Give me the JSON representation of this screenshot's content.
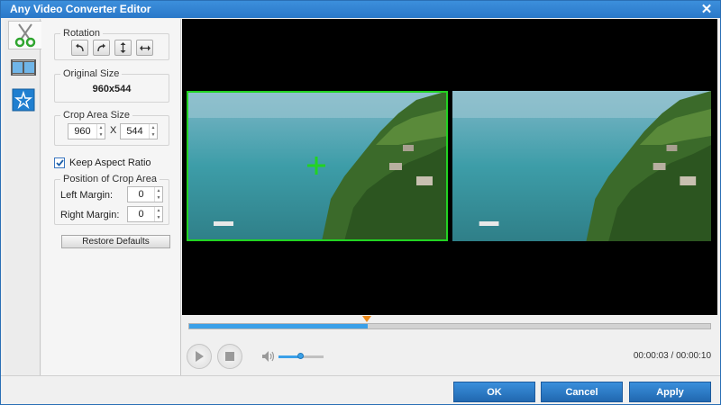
{
  "window": {
    "title": "Any Video Converter Editor",
    "close_symbol": "✕"
  },
  "tools": [
    {
      "name": "scissors-icon",
      "active": true
    },
    {
      "name": "film-icon",
      "active": false
    },
    {
      "name": "star-icon",
      "active": false
    }
  ],
  "rotation": {
    "label": "Rotation",
    "buttons": [
      "rotate-left-icon",
      "rotate-right-icon",
      "flip-vertical-icon",
      "flip-horizontal-icon"
    ]
  },
  "original_size": {
    "label": "Original Size",
    "value": "960x544"
  },
  "crop_area": {
    "label": "Crop Area Size",
    "width": "960",
    "height": "544",
    "separator": "X"
  },
  "keep_aspect": {
    "label": "Keep Aspect Ratio",
    "checked": true
  },
  "position": {
    "label": "Position of Crop Area",
    "left_label": "Left Margin:",
    "left_value": "0",
    "right_label": "Right Margin:",
    "right_value": "0"
  },
  "restore_label": "Restore Defaults",
  "playback": {
    "progress": 0.342,
    "volume": 0.5,
    "time": "00:00:03 / 00:00:10"
  },
  "buttons": {
    "ok": "OK",
    "cancel": "Cancel",
    "apply": "Apply"
  },
  "colors": {
    "accent": "#2a78c8",
    "crop_frame": "#22d322",
    "progress": "#3aa0e8",
    "marker": "#ec8a1c"
  }
}
